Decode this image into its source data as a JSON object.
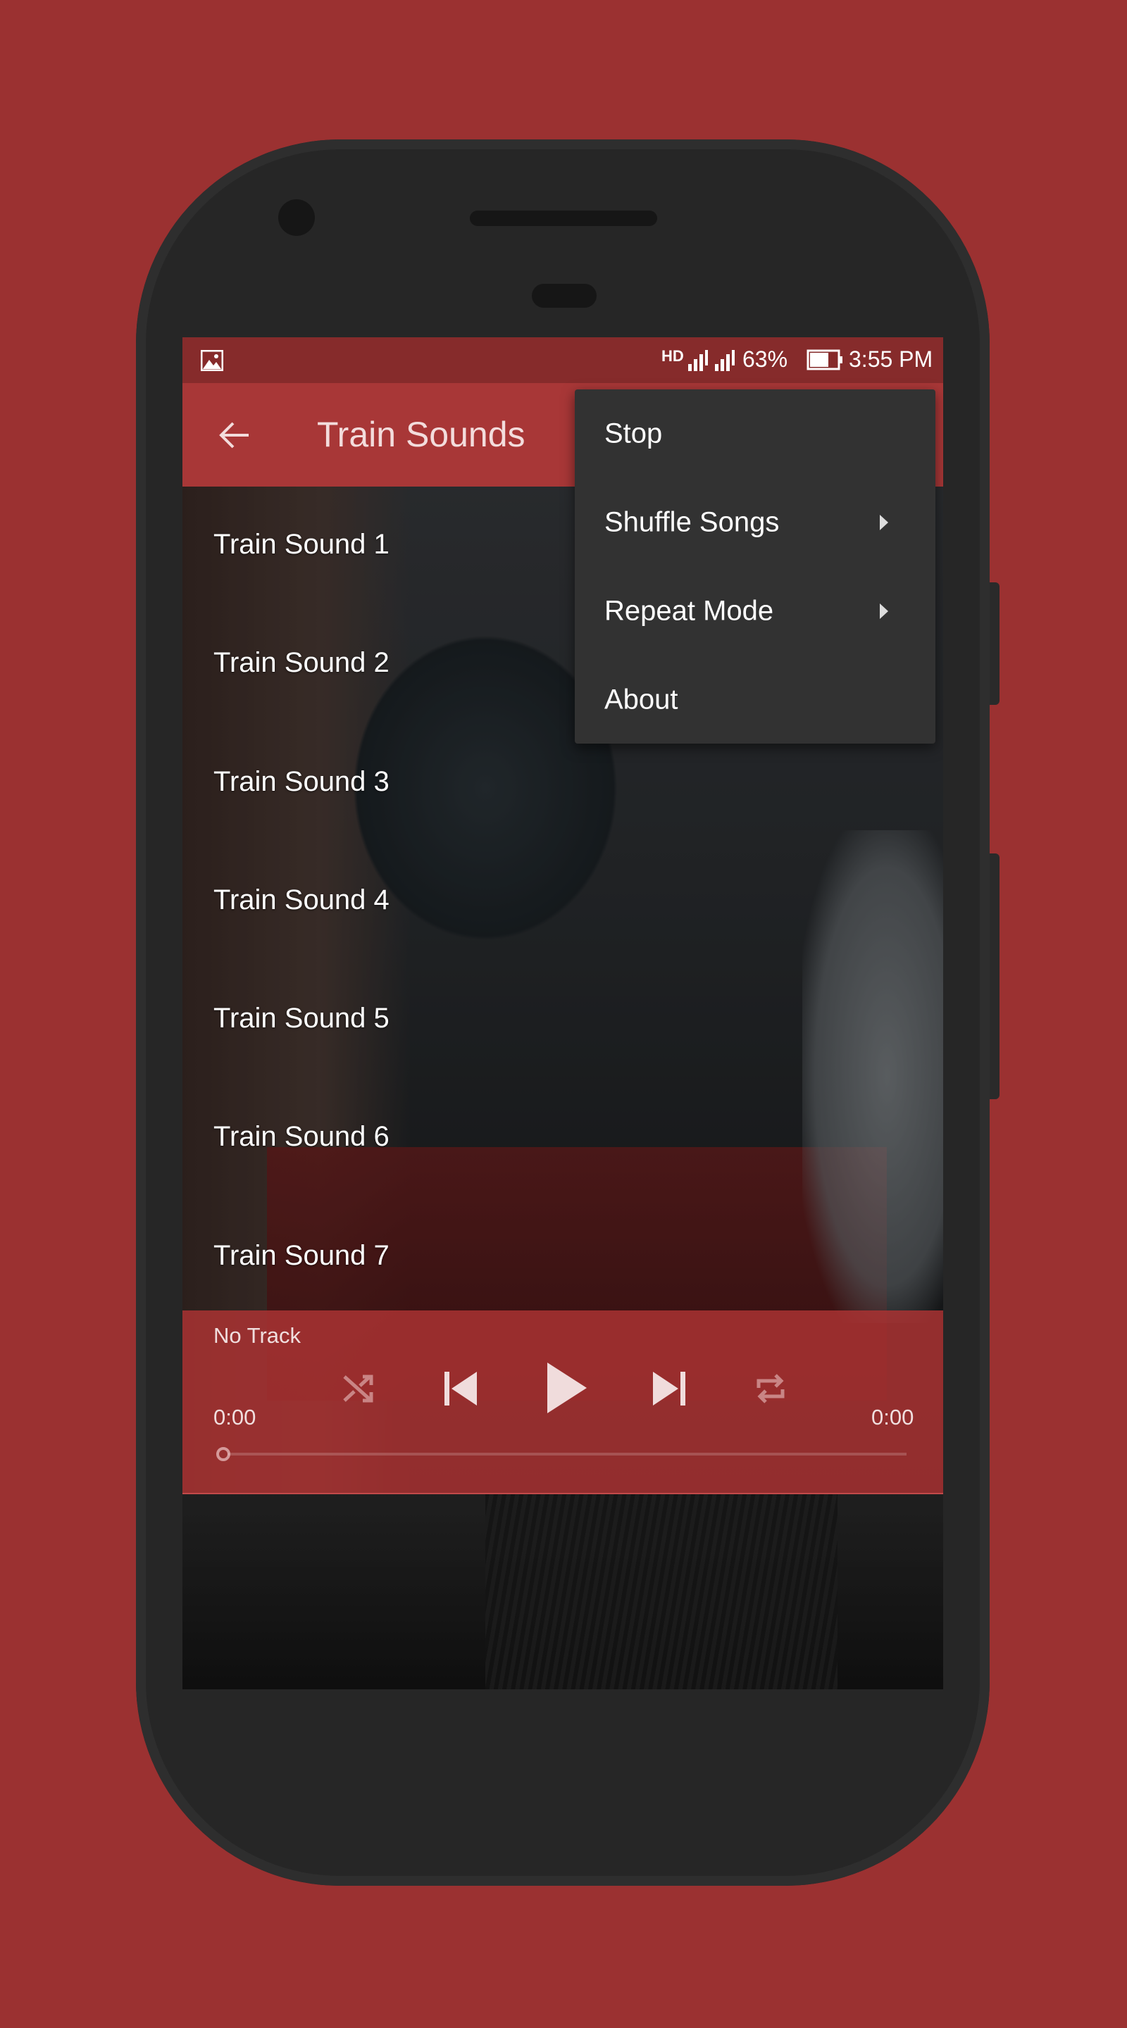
{
  "status_bar": {
    "battery": "63%",
    "time": "3:55 PM",
    "icons": [
      "image-icon",
      "hd-call-icon",
      "signal-1-icon",
      "signal-2-icon",
      "battery-icon"
    ]
  },
  "app_bar": {
    "title": "Train Sounds",
    "back_icon": "arrow-left-icon"
  },
  "tracks": [
    {
      "label": "Train Sound 1"
    },
    {
      "label": "Train Sound 2"
    },
    {
      "label": "Train Sound 3"
    },
    {
      "label": "Train Sound 4"
    },
    {
      "label": "Train Sound 5"
    },
    {
      "label": "Train Sound 6"
    },
    {
      "label": "Train Sound 7"
    }
  ],
  "player": {
    "track_title": "No Track",
    "elapsed": "0:00",
    "duration": "0:00",
    "progress": 0,
    "controls": [
      "shuffle-icon",
      "skip-previous-icon",
      "play-icon",
      "skip-next-icon",
      "repeat-icon"
    ]
  },
  "menu": {
    "items": [
      {
        "label": "Stop",
        "submenu": false
      },
      {
        "label": "Shuffle Songs",
        "submenu": true
      },
      {
        "label": "Repeat Mode",
        "submenu": true
      },
      {
        "label": "About",
        "submenu": false
      }
    ]
  },
  "colors": {
    "background": "#9b3131",
    "app_bar": "#a83737",
    "status_bar": "#862b2b",
    "menu": "#323232",
    "phone": "#262626"
  }
}
